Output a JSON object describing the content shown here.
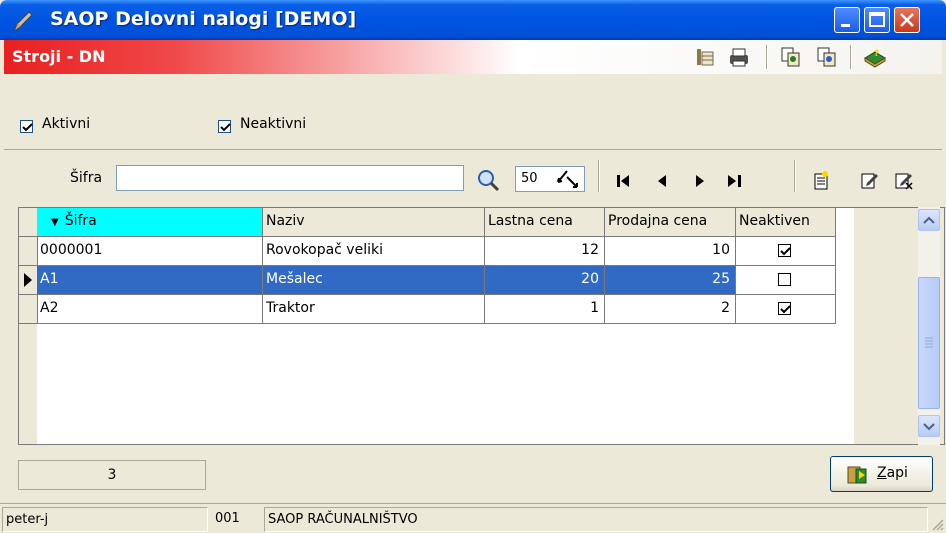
{
  "window": {
    "title": "SAOP Delovni nalogi [DEMO]"
  },
  "section": {
    "title": "Stroji - DN"
  },
  "filters": {
    "aktivni": {
      "label": "Aktivni",
      "checked": true
    },
    "neaktivni": {
      "label": "Neaktivni",
      "checked": true
    }
  },
  "search": {
    "label": "Šifra",
    "value": "",
    "count": "50"
  },
  "grid": {
    "columns": [
      "Šifra",
      "Naziv",
      "Lastna cena",
      "Prodajna cena",
      "Neaktiven"
    ],
    "rows": [
      {
        "sifra": "0000001",
        "naziv": "Rovokopač veliki",
        "lastna": "12",
        "prodajna": "10",
        "neaktiven": true
      },
      {
        "sifra": "A1",
        "naziv": "Mešalec",
        "lastna": "20",
        "prodajna": "25",
        "neaktiven": false
      },
      {
        "sifra": "A2",
        "naziv": "Traktor",
        "lastna": "1",
        "prodajna": "2",
        "neaktiven": true
      }
    ],
    "selected_row": 1
  },
  "footer": {
    "record_count": "3",
    "close_label": "Zapri",
    "close_accel": "Z"
  },
  "status": {
    "user": "peter-j",
    "company_code": "001",
    "company_name": "SAOP RAČUNALNIŠTVO"
  },
  "colors": {
    "accent": "#316ac5",
    "header_red": "#e82020",
    "sort_col": "#00ffff"
  }
}
